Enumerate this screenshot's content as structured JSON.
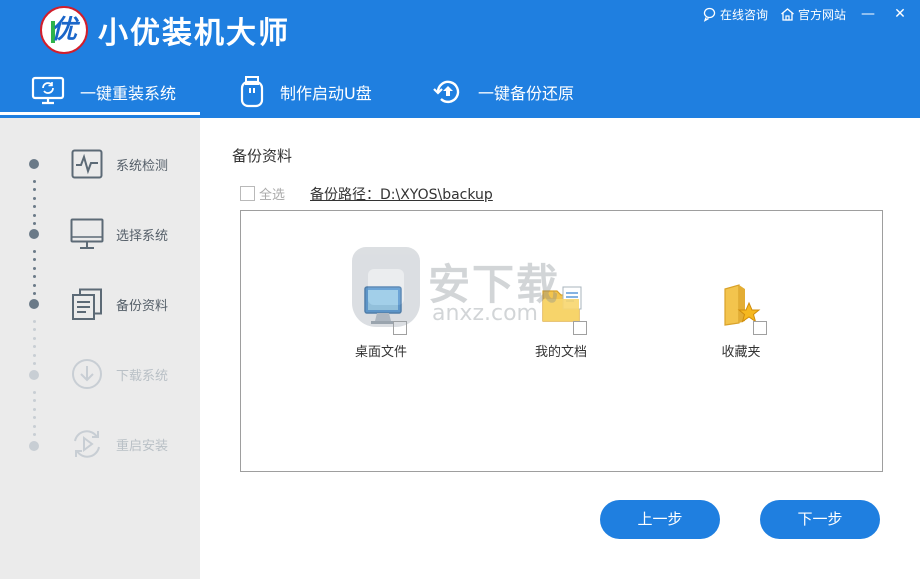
{
  "app": {
    "title": "小优装机大师",
    "logo_glyph": "优"
  },
  "top_links": {
    "consult": "在线咨询",
    "website": "官方网站",
    "minimize": "—",
    "close": "✕"
  },
  "tabs": [
    {
      "label": "一键重装系统",
      "icon": "monitor-refresh-icon",
      "active": true
    },
    {
      "label": "制作启动U盘",
      "icon": "usb-drive-icon",
      "active": false
    },
    {
      "label": "一键备份还原",
      "icon": "backup-restore-icon",
      "active": false
    }
  ],
  "steps": [
    {
      "label": "系统检测",
      "icon": "heartbeat-monitor-icon",
      "state": "done"
    },
    {
      "label": "选择系统",
      "icon": "desktop-monitor-icon",
      "state": "done"
    },
    {
      "label": "备份资料",
      "icon": "documents-icon",
      "state": "current"
    },
    {
      "label": "下载系统",
      "icon": "download-icon",
      "state": "pending"
    },
    {
      "label": "重启安装",
      "icon": "restart-icon",
      "state": "pending"
    }
  ],
  "main": {
    "title": "备份资料",
    "select_all_label": "全选",
    "backup_path": "备份路径：D:\\XYOS\\backup",
    "items": [
      {
        "label": "桌面文件",
        "icon": "desktop-computer-icon"
      },
      {
        "label": "我的文档",
        "icon": "my-documents-folder-icon"
      },
      {
        "label": "收藏夹",
        "icon": "favorites-folder-icon"
      }
    ]
  },
  "watermark": {
    "text": "安下载",
    "url_text": "anxz.com"
  },
  "buttons": {
    "prev": "上一步",
    "next": "下一步"
  },
  "colors": {
    "primary": "#1f7fe0",
    "sidebar_bg": "#ebebeb",
    "step_done": "#6b7a88",
    "step_pending": "#c8ced4",
    "logo_border": "#d21e2b"
  }
}
